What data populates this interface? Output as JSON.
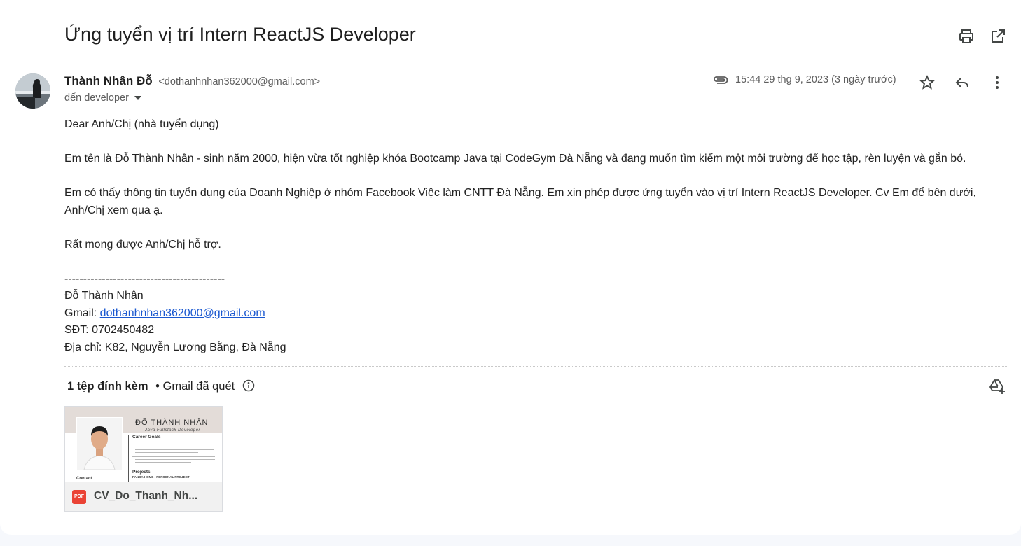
{
  "subject": "Ứng tuyển vị trí Intern ReactJS Developer",
  "toolbar": {
    "print_icon": "print-icon",
    "open_new_window_icon": "open-in-new-window-icon"
  },
  "sender": {
    "name": "Thành Nhân Đỗ",
    "email": "<dothanhnhan362000@gmail.com>",
    "to_label": "đến developer"
  },
  "meta": {
    "datetime": "15:44 29 thg 9, 2023 (3 ngày trước)",
    "attachment_icon": "paperclip-icon",
    "star_icon": "star-icon",
    "reply_icon": "reply-icon",
    "more_icon": "more-vert-icon"
  },
  "body": {
    "greeting": "Dear Anh/Chị (nhà tuyển dụng)",
    "para1": "Em tên là Đỗ Thành Nhân - sinh năm 2000, hiện vừa tốt nghiệp khóa Bootcamp Java tại CodeGym Đà Nẵng và đang muốn tìm kiếm một môi trường để học tập, rèn luyện và gắn bó.",
    "para2": "Em có thấy thông tin tuyển dụng của Doanh Nghiệp ở nhóm Facebook Việc làm CNTT Đà Nẵng. Em xin phép được ứng tuyển vào vị trí Intern ReactJS Developer. Cv Em để bên dưới, Anh/Chị xem qua ạ.",
    "para3": "Rất mong được Anh/Chị hỗ trợ.",
    "separator": "-------------------------------------------",
    "sig_name": "Đỗ Thành Nhân",
    "sig_gmail_label": "Gmail: ",
    "sig_gmail_link": "dothanhnhan362000@gmail.com",
    "sig_phone": "SĐT: 0702450482",
    "sig_address": "Địa chỉ: K82, Nguyễn Lương Bằng, Đà Nẵng"
  },
  "attachments": {
    "count_label": "1 tệp đính kèm",
    "scan_label": "• Gmail đã quét",
    "info_icon": "info-icon",
    "drive_icon": "add-to-drive-icon",
    "file": {
      "name": "CV_Do_Thanh_Nh...",
      "type_badge": "PDF",
      "preview": {
        "name": "ĐỖ THÀNH NHÂN",
        "role": "Java Fullstack Developer",
        "section1": "Career Goals",
        "section2": "Projects",
        "project_title": "PANDA HOME - PERSONAL PROJECT",
        "contact": "Contact"
      }
    }
  },
  "colors": {
    "link": "#1a58d0",
    "pdf_red": "#ea4335",
    "text": "#1f1f1f",
    "muted": "#5e5e5e"
  }
}
